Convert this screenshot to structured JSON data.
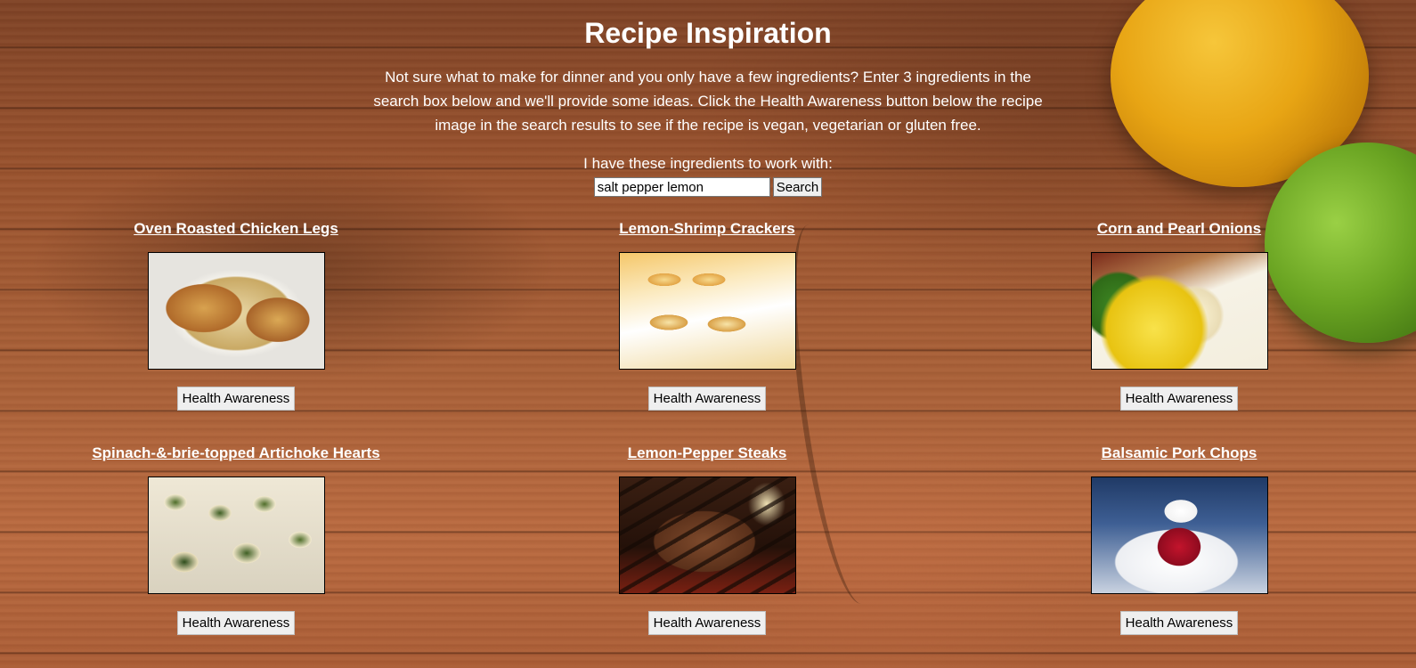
{
  "header": {
    "title": "Recipe Inspiration",
    "description": "Not sure what to make for dinner and you only have a few ingredients? Enter 3 ingredients in the search box below and we'll provide some ideas. Click the Health Awareness button below the recipe image in the search results to see if the recipe is vegan, vegetarian or gluten free."
  },
  "search": {
    "prompt": "I have these ingredients to work with:",
    "value": "salt pepper lemon",
    "button_label": "Search"
  },
  "recipes": [
    {
      "title": "Oven Roasted Chicken Legs",
      "button_label": "Health Awareness"
    },
    {
      "title": "Lemon-Shrimp Crackers",
      "button_label": "Health Awareness"
    },
    {
      "title": "Corn and Pearl Onions",
      "button_label": "Health Awareness"
    },
    {
      "title": "Spinach-&-brie-topped Artichoke Hearts",
      "button_label": "Health Awareness"
    },
    {
      "title": "Lemon-Pepper Steaks",
      "button_label": "Health Awareness"
    },
    {
      "title": "Balsamic Pork Chops",
      "button_label": "Health Awareness"
    }
  ]
}
